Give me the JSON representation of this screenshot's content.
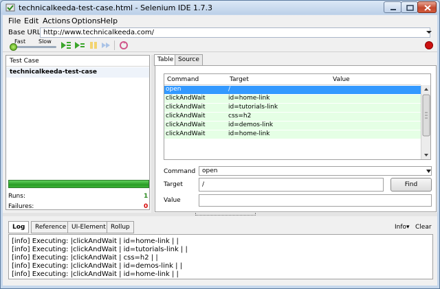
{
  "window": {
    "title": "technicalkeeda-test-case.html - Selenium IDE 1.7.3"
  },
  "menu": [
    "File",
    "Edit",
    "Actions",
    "Options",
    "Help"
  ],
  "base_url": {
    "label": "Base URL",
    "value": "http://www.technicalkeeda.com/"
  },
  "toolbar": {
    "fast_label": "Fast",
    "slow_label": "Slow",
    "speed_level": 0.0,
    "icons": [
      "play-suite-icon",
      "play-test-icon",
      "pause-icon",
      "step-icon",
      "rollup-icon",
      "record-icon"
    ]
  },
  "test_case": {
    "header": "Test Case",
    "name": "technicalkeeda-test-case",
    "runs_label": "Runs:",
    "runs_value": "1",
    "failures_label": "Failures:",
    "failures_value": "0"
  },
  "tabs": [
    "Table",
    "Source"
  ],
  "command_table": {
    "headers": [
      "Command",
      "Target",
      "Value"
    ],
    "rows": [
      {
        "command": "open",
        "target": "/",
        "value": ""
      },
      {
        "command": "clickAndWait",
        "target": "id=home-link",
        "value": ""
      },
      {
        "command": "clickAndWait",
        "target": "id=tutorials-link",
        "value": ""
      },
      {
        "command": "clickAndWait",
        "target": "css=h2",
        "value": ""
      },
      {
        "command": "clickAndWait",
        "target": "id=demos-link",
        "value": ""
      },
      {
        "command": "clickAndWait",
        "target": "id=home-link",
        "value": ""
      }
    ]
  },
  "editor": {
    "command_label": "Command",
    "command_value": "open",
    "target_label": "Target",
    "target_value": "/",
    "find_label": "Find",
    "value_label": "Value",
    "value_value": ""
  },
  "log_panel": {
    "tabs": [
      "Log",
      "Reference",
      "UI-Element",
      "Rollup"
    ],
    "info_label": "Info▾",
    "clear_label": "Clear",
    "lines": [
      "[info] Executing: |clickAndWait | id=home-link | |",
      "[info] Executing: |clickAndWait | id=tutorials-link | |",
      "[info] Executing: |clickAndWait | css=h2 | |",
      "[info] Executing: |clickAndWait | id=demos-link | |",
      "[info] Executing: |clickAndWait | id=home-link | |"
    ]
  },
  "colors": {
    "selected_row": "#3399ff",
    "row_bg": "#e5ffe5",
    "runs_color": "#2a8a1e",
    "failures_color": "#d40000",
    "record_color": "#cc1111"
  }
}
